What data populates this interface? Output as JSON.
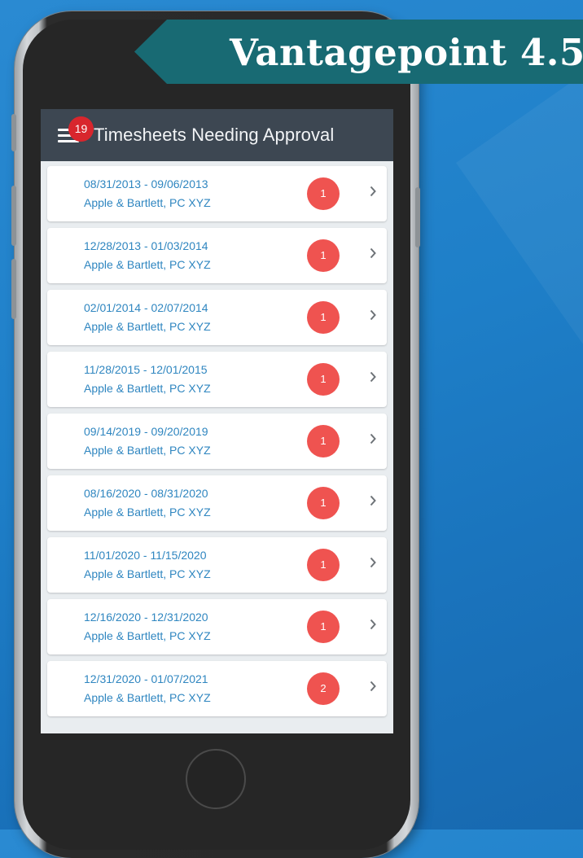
{
  "banner": {
    "title": "Vantagepoint 4.5",
    "color": "#186a73"
  },
  "header": {
    "title": "Timesheets Needing Approval",
    "notification_count": "19"
  },
  "timesheets": [
    {
      "dates": "08/31/2013 - 09/06/2013",
      "client": "Apple & Bartlett, PC XYZ",
      "count": "1"
    },
    {
      "dates": "12/28/2013 - 01/03/2014",
      "client": "Apple & Bartlett, PC XYZ",
      "count": "1"
    },
    {
      "dates": "02/01/2014 - 02/07/2014",
      "client": "Apple & Bartlett, PC XYZ",
      "count": "1"
    },
    {
      "dates": "11/28/2015 - 12/01/2015",
      "client": "Apple & Bartlett, PC XYZ",
      "count": "1"
    },
    {
      "dates": "09/14/2019 - 09/20/2019",
      "client": "Apple & Bartlett, PC XYZ",
      "count": "1"
    },
    {
      "dates": "08/16/2020 - 08/31/2020",
      "client": "Apple & Bartlett, PC XYZ",
      "count": "1"
    },
    {
      "dates": "11/01/2020 - 11/15/2020",
      "client": "Apple & Bartlett, PC XYZ",
      "count": "1"
    },
    {
      "dates": "12/16/2020 - 12/31/2020",
      "client": "Apple & Bartlett, PC XYZ",
      "count": "1"
    },
    {
      "dates": "12/31/2020 - 01/07/2021",
      "client": "Apple & Bartlett, PC XYZ",
      "count": "2"
    }
  ],
  "icons": {
    "menu": "hamburger-menu-icon",
    "row_action": "chevron-right-icon"
  },
  "colors": {
    "header_bg": "#3d4752",
    "badge": "#d8262d",
    "count_badge": "#ef5350",
    "link_text": "#2f86c0",
    "list_bg": "#e9edf0"
  }
}
